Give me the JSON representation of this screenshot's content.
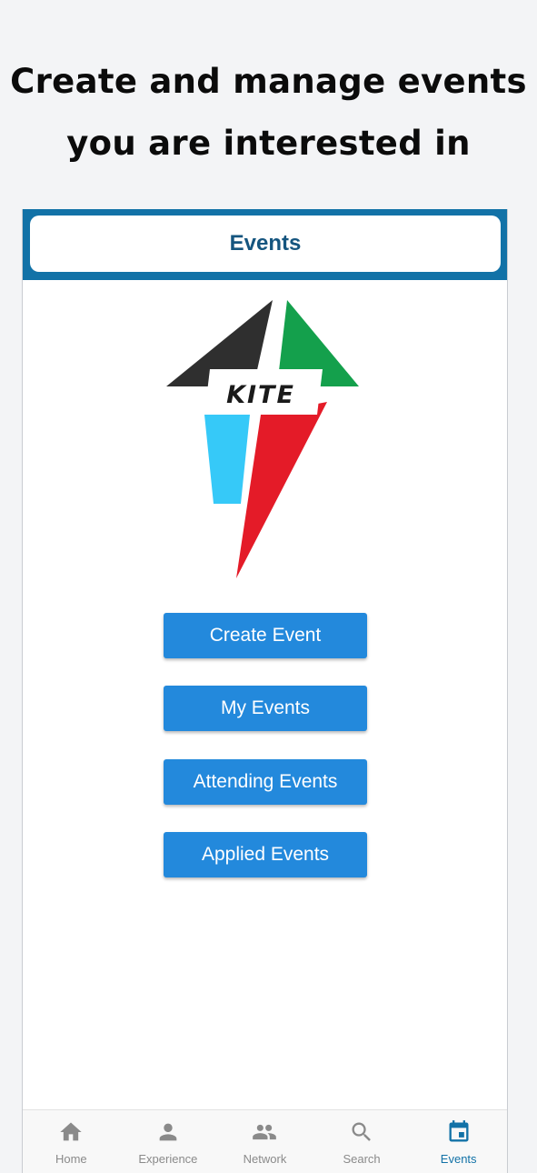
{
  "headline": {
    "line1": "Create and manage events",
    "line2": "you are interested in"
  },
  "appbar": {
    "title": "Events"
  },
  "logo": {
    "text": "KITE",
    "colors": {
      "black": "#2f2f2f",
      "green": "#14a04c",
      "cyan": "#36c9f8",
      "red": "#e41b28"
    }
  },
  "buttons": [
    {
      "label": "Create Event"
    },
    {
      "label": "My Events"
    },
    {
      "label": "Attending Events"
    },
    {
      "label": "Applied Events"
    }
  ],
  "bottom_nav": {
    "items": [
      {
        "label": "Home",
        "icon": "home-icon",
        "active": false
      },
      {
        "label": "Experience",
        "icon": "person-icon",
        "active": false
      },
      {
        "label": "Network",
        "icon": "people-icon",
        "active": false
      },
      {
        "label": "Search",
        "icon": "search-icon",
        "active": false
      },
      {
        "label": "Events",
        "icon": "calendar-icon",
        "active": true
      }
    ]
  },
  "colors": {
    "accent": "#1272a7",
    "button": "#2389dc",
    "title": "#15557f",
    "inactive": "#8a8a8a"
  }
}
